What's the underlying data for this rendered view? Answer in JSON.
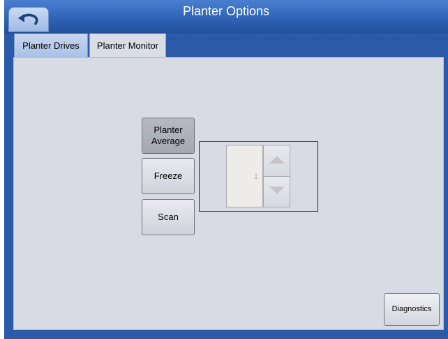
{
  "window": {
    "title": "Planter Options"
  },
  "icons": {
    "back": "back-arrow-icon",
    "up": "triangle-up-icon",
    "down": "triangle-down-icon"
  },
  "tabs": [
    {
      "label": "Planter Drives",
      "active": false
    },
    {
      "label": "Planter Monitor",
      "active": true
    }
  ],
  "buttons": {
    "planter_average": "Planter\nAverage",
    "freeze": "Freeze",
    "scan": "Scan",
    "diagnostics": "Diagnostics"
  },
  "spinner": {
    "value": "1"
  },
  "colors": {
    "title_bar": "#2f63b6",
    "panel": "#d8dbe4",
    "active_button": "#a4a8b1"
  }
}
